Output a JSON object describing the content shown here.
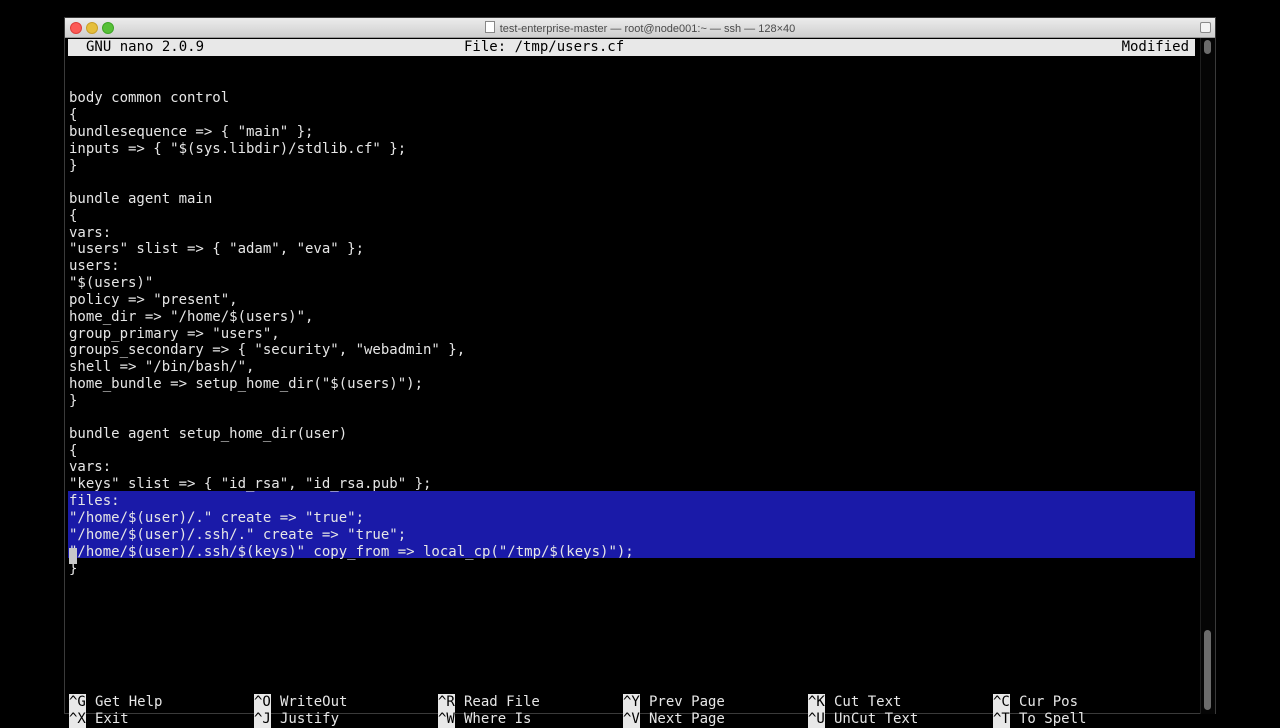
{
  "window": {
    "title": "test-enterprise-master — root@node001:~ — ssh — 128×40"
  },
  "nano": {
    "version": "GNU nano 2.0.9",
    "file": "File: /tmp/users.cf",
    "status": "Modified"
  },
  "editor": {
    "lines": [
      "body common control",
      "{",
      "bundlesequence => { \"main\" };",
      "inputs => { \"$(sys.libdir)/stdlib.cf\" };",
      "}",
      "",
      "bundle agent main",
      "{",
      "vars:",
      "\"users\" slist => { \"adam\", \"eva\" };",
      "users:",
      "\"$(users)\"",
      "policy => \"present\",",
      "home_dir => \"/home/$(users)\",",
      "group_primary => \"users\",",
      "groups_secondary => { \"security\", \"webadmin\" },",
      "shell => \"/bin/bash/\",",
      "home_bundle => setup_home_dir(\"$(users)\");",
      "}",
      "",
      "bundle agent setup_home_dir(user)",
      "{",
      "vars:",
      "\"keys\" slist => { \"id_rsa\", \"id_rsa.pub\" };",
      "files:",
      "\"/home/$(user)/.\" create => \"true\";",
      "\"/home/$(user)/.ssh/.\" create => \"true\";",
      "\"/home/$(user)/.ssh/$(keys)\" copy_from => local_cp(\"/tmp/$(keys)\");",
      "}"
    ]
  },
  "shortcuts": [
    {
      "key": "^G",
      "label": "Get Help"
    },
    {
      "key": "^O",
      "label": "WriteOut"
    },
    {
      "key": "^R",
      "label": "Read File"
    },
    {
      "key": "^Y",
      "label": "Prev Page"
    },
    {
      "key": "^K",
      "label": "Cut Text"
    },
    {
      "key": "^C",
      "label": "Cur Pos"
    },
    {
      "key": "^X",
      "label": "Exit"
    },
    {
      "key": "^J",
      "label": "Justify"
    },
    {
      "key": "^W",
      "label": "Where Is"
    },
    {
      "key": "^V",
      "label": "Next Page"
    },
    {
      "key": "^U",
      "label": "UnCut Text"
    },
    {
      "key": "^T",
      "label": "To Spell"
    }
  ],
  "colors": {
    "selection": "#1a1aa8",
    "header_bg": "#e8e8e8",
    "text": "#e6e6e6"
  }
}
